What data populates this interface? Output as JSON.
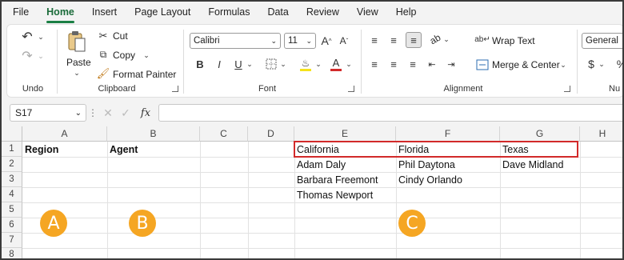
{
  "menu": [
    "File",
    "Home",
    "Insert",
    "Page Layout",
    "Formulas",
    "Data",
    "Review",
    "View",
    "Help"
  ],
  "active_menu": "Home",
  "ribbon": {
    "undo": {
      "label": "Undo"
    },
    "clipboard": {
      "paste": "Paste",
      "cut": "Cut",
      "copy": "Copy",
      "format_painter": "Format Painter",
      "label": "Clipboard"
    },
    "font": {
      "family": "Calibri",
      "size": "11",
      "label": "Font"
    },
    "alignment": {
      "wrap": "Wrap Text",
      "merge": "Merge & Center",
      "label": "Alignment"
    },
    "number": {
      "format": "General",
      "label": "Nu"
    }
  },
  "formula_bar": {
    "name_box": "S17",
    "fx": "fx",
    "formula": ""
  },
  "columns": [
    "A",
    "B",
    "C",
    "D",
    "E",
    "F",
    "G",
    "H"
  ],
  "rows": [
    "1",
    "2",
    "3",
    "4",
    "5",
    "6",
    "7",
    "8"
  ],
  "cells": {
    "A1": "Region",
    "B1": "Agent",
    "E1": "California",
    "F1": "Florida",
    "G1": "Texas",
    "E2": "Adam Daly",
    "F2": "Phil Daytona",
    "G2": "Dave Midland",
    "E3": "Barbara Freemont",
    "F3": "Cindy Orlando",
    "E4": "Thomas Newport"
  },
  "callouts": [
    "A",
    "B",
    "C"
  ],
  "colors": {
    "accent": "#1b7f44",
    "highlight": "#d22a2a",
    "callout": "#f5a623"
  }
}
